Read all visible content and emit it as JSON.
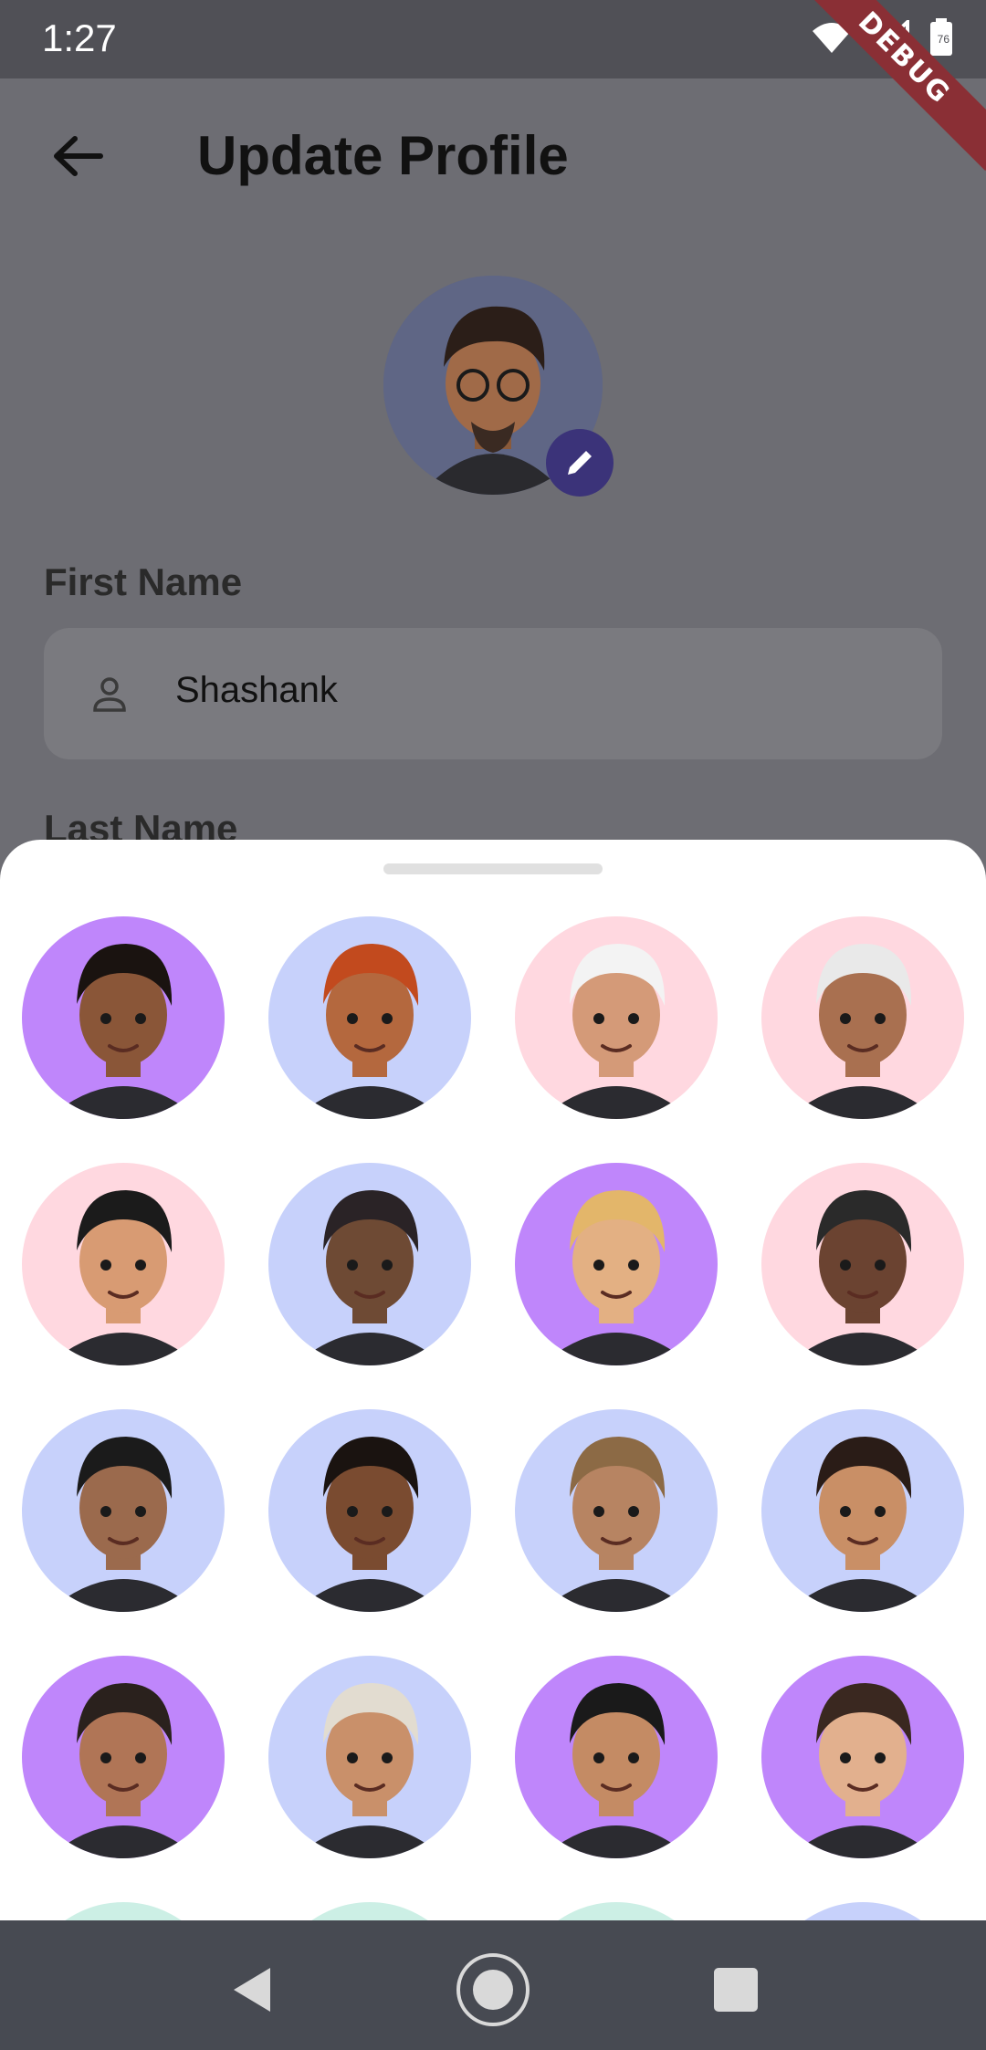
{
  "status_bar": {
    "time": "1:27",
    "battery": "76",
    "debug_label": "DEBUG"
  },
  "header": {
    "title": "Update Profile"
  },
  "form": {
    "first_name_label": "First Name",
    "first_name_value": "Shashank",
    "last_name_label": "Last Name"
  },
  "avatar_picker": {
    "rows": [
      [
        "purple",
        "blue",
        "pink",
        "pink"
      ],
      [
        "pink",
        "blue",
        "purple",
        "pink"
      ],
      [
        "blue",
        "blue",
        "blue",
        "blue"
      ],
      [
        "purple",
        "blue",
        "purple",
        "purple"
      ]
    ],
    "partial_row": [
      "mint",
      "mint",
      "mint",
      "blue"
    ]
  },
  "colors": {
    "purple": "#bf86fb",
    "blue": "#c7d1fb",
    "pink": "#ffd8e0",
    "mint": "#ccefe5",
    "accent": "#3b3379"
  },
  "icons": {
    "back": "arrow-left-icon",
    "edit": "pencil-icon",
    "person": "person-icon",
    "nav_back": "triangle-back-icon",
    "nav_home": "circle-home-icon",
    "nav_recents": "square-recents-icon"
  }
}
